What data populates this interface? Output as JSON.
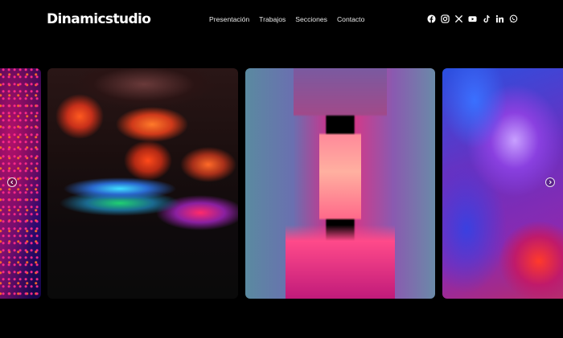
{
  "header": {
    "logo": "Dinamicstudio",
    "nav": [
      {
        "label": "Presentación"
      },
      {
        "label": "Trabajos"
      },
      {
        "label": "Secciones"
      },
      {
        "label": "Contacto"
      }
    ],
    "socials": [
      "facebook-icon",
      "instagram-icon",
      "x-icon",
      "youtube-icon",
      "tiktok-icon",
      "linkedin-icon",
      "whatsapp-icon"
    ]
  },
  "carousel": {
    "slides": [
      "magenta-particles",
      "neon-reflections",
      "neon-corridor",
      "purple-blur"
    ],
    "prev_icon": "chevron-left-icon",
    "next_icon": "chevron-right-icon"
  },
  "colors": {
    "background": "#000000",
    "text": "#ffffff"
  }
}
